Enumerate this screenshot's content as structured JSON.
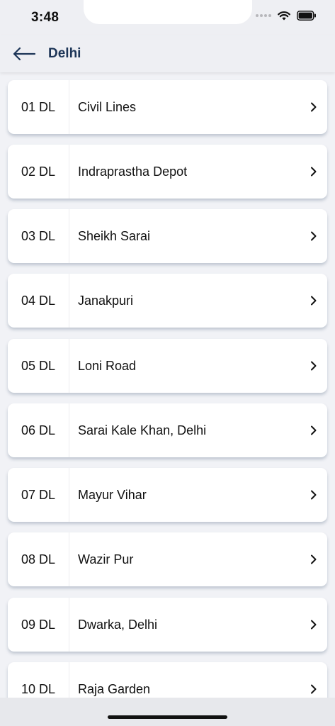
{
  "status": {
    "time": "3:48"
  },
  "header": {
    "title": "Delhi",
    "back_icon": "arrow-left-icon"
  },
  "items": [
    {
      "code": "01 DL",
      "name": "Civil Lines"
    },
    {
      "code": "02 DL",
      "name": "Indraprastha Depot"
    },
    {
      "code": "03 DL",
      "name": "Sheikh Sarai"
    },
    {
      "code": "04 DL",
      "name": "Janakpuri"
    },
    {
      "code": "05 DL",
      "name": "Loni Road"
    },
    {
      "code": "06 DL",
      "name": "Sarai Kale Khan, Delhi"
    },
    {
      "code": "07 DL",
      "name": "Mayur Vihar"
    },
    {
      "code": "08 DL",
      "name": "Wazir Pur"
    },
    {
      "code": "09 DL",
      "name": "Dwarka, Delhi"
    },
    {
      "code": "10 DL",
      "name": "Raja Garden"
    }
  ],
  "colors": {
    "title": "#1d3557",
    "background": "#f1f2f6",
    "card": "#ffffff"
  }
}
